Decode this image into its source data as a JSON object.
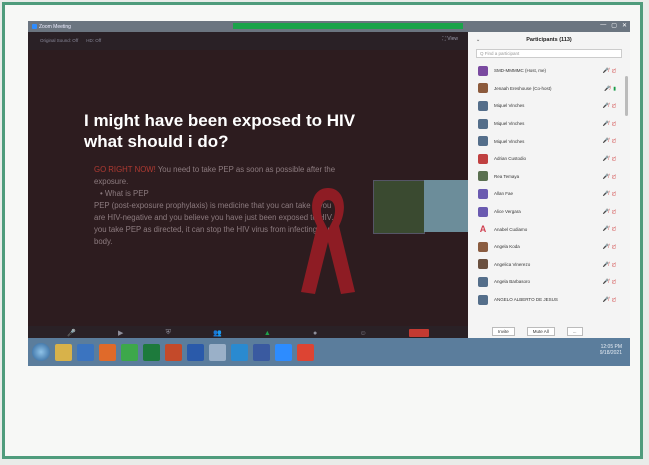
{
  "window": {
    "title": "Zoom Meeting",
    "controls": [
      "—",
      "▢",
      "✕"
    ]
  },
  "topbar": {
    "items": [
      "Original Sound: Off",
      "HD: Off"
    ],
    "right": "⛶ View"
  },
  "slide": {
    "title": "I might have been exposed to HIV what should i do?",
    "bullets": [
      {
        "highlight": "GO RIGHT NOW!",
        "text": " You need to take PEP as soon as possible after the exposure."
      },
      {
        "text": "• What is PEP"
      }
    ],
    "body": "PEP (post-exposure prophylaxis) is medicine that you can take if you are HIV-negative and you believe you have just been exposed to HIV. If you take PEP as directed, it can stop the HIV virus from infecting your body."
  },
  "panel": {
    "title": "Participants (113)",
    "search_placeholder": "Q Find a participant",
    "participants": [
      {
        "name": "SMD-MMMMC (Host, me)",
        "color": "#7a4aa0"
      },
      {
        "name": "Jenaah Ereshouse (Co-host)",
        "color": "#8c5a3c",
        "video": true
      },
      {
        "name": "Miquel Vinches",
        "color": "#546e8a"
      },
      {
        "name": "Miquel Vinches",
        "color": "#546e8a"
      },
      {
        "name": "Miquel Vinches",
        "color": "#546e8a"
      },
      {
        "name": "Adrian Custodio",
        "color": "#c04040"
      },
      {
        "name": "Rea Temaya",
        "color": "#5a7050"
      },
      {
        "name": "Allan Fae",
        "color": "#6a5ab0"
      },
      {
        "name": "Alice Vergara",
        "color": "#6a5ab0"
      },
      {
        "name": "Anabel Cudiamo",
        "color": "#d04050",
        "letter": "A"
      },
      {
        "name": "Angela Koda",
        "color": "#8a5c40"
      },
      {
        "name": "Angelica Vinerezo",
        "color": "#6a5040"
      },
      {
        "name": "Angela Barbasoro",
        "color": "#546e8a"
      },
      {
        "name": "ANGELO ALBERTO DE JESUS",
        "color": "#546e8a"
      }
    ],
    "footer": [
      "Invite",
      "Mute All",
      "..."
    ]
  },
  "controls": [
    "Unmute",
    "Stop Video",
    "Security",
    "Participants",
    "Share Screen",
    "Record",
    "Reactions",
    "End"
  ],
  "tray": {
    "time": "12:05 PM",
    "date": "9/18/2021"
  }
}
